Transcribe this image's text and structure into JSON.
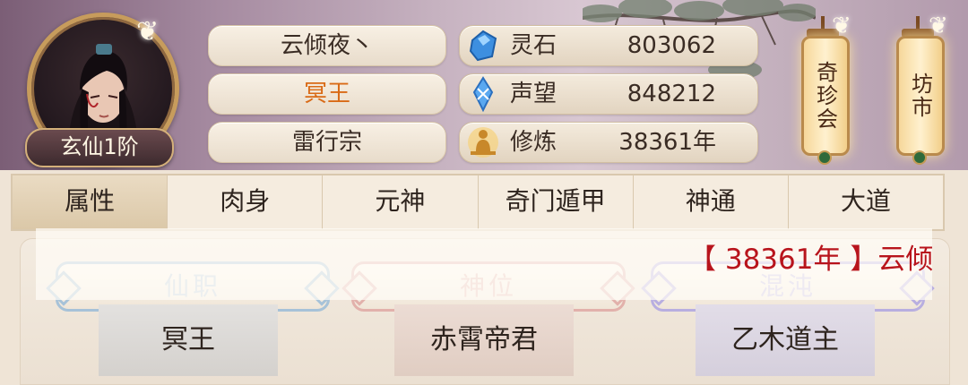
{
  "player": {
    "name": "云倾夜丶",
    "title": "冥王",
    "sect": "雷行宗",
    "rank": "玄仙1阶"
  },
  "resources": [
    {
      "icon": "spirit-stone-icon",
      "label": "灵石",
      "value": "803062"
    },
    {
      "icon": "reputation-icon",
      "label": "声望",
      "value": "848212"
    },
    {
      "icon": "cultivation-icon",
      "label": "修炼",
      "value": "38361年"
    }
  ],
  "shops": [
    {
      "label": "奇珍会"
    },
    {
      "label": "坊市"
    }
  ],
  "tabs": [
    "属性",
    "肉身",
    "元神",
    "奇门遁甲",
    "神通",
    "大道"
  ],
  "active_tab": 0,
  "stats": [
    {
      "header": "仙职",
      "value": "冥王"
    },
    {
      "header": "神位",
      "value": "赤霄帝君"
    },
    {
      "header": "混沌",
      "value": "乙木道主"
    }
  ],
  "broadcast": "【 38361年 】云倾",
  "colors": {
    "title_orange": "#d96a16",
    "broadcast_red": "#b8141c"
  }
}
